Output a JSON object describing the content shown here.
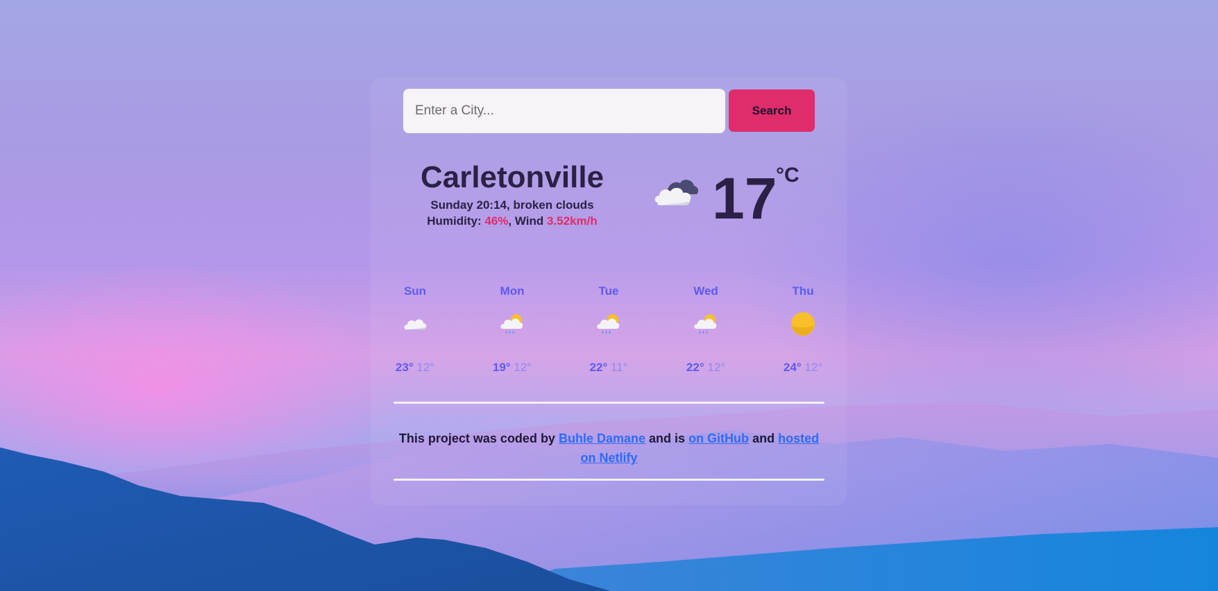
{
  "search": {
    "placeholder": "Enter a City...",
    "button_label": "Search"
  },
  "current": {
    "city": "Carletonville",
    "day_time": "Sunday 20:14",
    "description": "broken clouds",
    "humidity_label": "Humidity:",
    "humidity": "46%",
    "wind_label": "Wind",
    "wind": "3.52km/h",
    "temperature": "17",
    "unit": "°C",
    "icon": "broken-clouds-icon"
  },
  "forecast": [
    {
      "day": "Sun",
      "max": "23°",
      "min": "12°",
      "icon": "cloud-icon"
    },
    {
      "day": "Mon",
      "max": "19°",
      "min": "12°",
      "icon": "sun-rain-cloud-icon"
    },
    {
      "day": "Tue",
      "max": "22°",
      "min": "11°",
      "icon": "sun-rain-cloud-icon"
    },
    {
      "day": "Wed",
      "max": "22°",
      "min": "12°",
      "icon": "sun-rain-cloud-icon"
    },
    {
      "day": "Thu",
      "max": "24°",
      "min": "12°",
      "icon": "sun-icon"
    }
  ],
  "footer": {
    "text_1": "This project was coded by",
    "author_link": "Buhle Damane",
    "text_2": "and is",
    "github_link": "on GitHub",
    "text_3": "and",
    "netlify_link": "hosted on Netlify"
  },
  "colors": {
    "accent": "#df2c6a",
    "forecast_text": "#5d5af0",
    "link": "#2f6bf5"
  }
}
